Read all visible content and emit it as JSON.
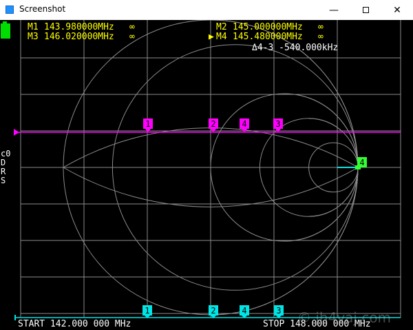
{
  "window": {
    "title": "Screenshot",
    "controls": {
      "minimize": "—",
      "close": "✕"
    }
  },
  "markers_header": {
    "m1": {
      "label": "M1",
      "freq": "143.980000MHz",
      "value": "∞"
    },
    "m2": {
      "label": "M2",
      "freq": "145.000000MHz",
      "value": "∞"
    },
    "m3": {
      "label": "M3",
      "freq": "146.020000MHz",
      "value": "∞"
    },
    "m4": {
      "label": "M4",
      "freq": "145.480000MHz",
      "value": "∞"
    },
    "delta": "Δ4-3 -540.000kHz",
    "active_marker_glyph": "▶"
  },
  "side_labels": {
    "line1": "c0",
    "line2": "D",
    "line3": "R",
    "line4": "S"
  },
  "top_markers": [
    {
      "label": "1",
      "color": "#ff00ff"
    },
    {
      "label": "2",
      "color": "#ff00ff"
    },
    {
      "label": "4",
      "color": "#ff00ff"
    },
    {
      "label": "3",
      "color": "#ff00ff"
    }
  ],
  "bottom_markers": [
    {
      "label": "1",
      "color": "#00e5e5"
    },
    {
      "label": "2",
      "color": "#00e5e5"
    },
    {
      "label": "4",
      "color": "#00e5e5"
    },
    {
      "label": "3",
      "color": "#00e5e5"
    }
  ],
  "right_marker": {
    "label": "4",
    "color": "#33ff33"
  },
  "footer": {
    "start": "START 142.000 000 MHz",
    "stop": "STOP 148.000 000 MHz"
  },
  "watermark": "© jh4vaj.com",
  "colors": {
    "marker_text": "#ffff00",
    "trace_magenta": "#ff00ff",
    "trace_cyan": "#00e5e5",
    "grid": "#8c8c8c",
    "battery": "#00dd00"
  }
}
